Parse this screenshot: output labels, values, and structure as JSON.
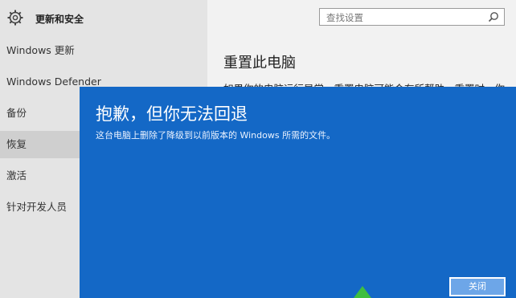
{
  "sidebar": {
    "title": "更新和安全",
    "items": [
      {
        "label": "Windows 更新"
      },
      {
        "label": "Windows Defender"
      },
      {
        "label": "备份"
      },
      {
        "label": "恢复"
      },
      {
        "label": "激活"
      },
      {
        "label": "针对开发人员"
      }
    ]
  },
  "search": {
    "placeholder": "查找设置"
  },
  "main": {
    "heading": "重置此电脑",
    "partial_text": "如果你的电脑运行异常，重置电脑可能会有所帮助。重置时，你"
  },
  "dialog": {
    "title": "抱歉，但你无法回退",
    "message": "这台电脑上删除了降级到以前版本的 Windows 所需的文件。",
    "close_label": "关闭"
  },
  "colors": {
    "dialog_bg": "#1468c6",
    "selected_bg": "#cfcfcf"
  }
}
